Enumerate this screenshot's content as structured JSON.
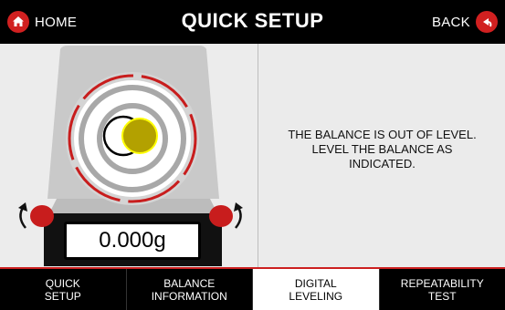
{
  "header": {
    "home_label": "HOME",
    "title": "QUICK SETUP",
    "back_label": "BACK"
  },
  "display": {
    "weight": "0.000g"
  },
  "message": {
    "lines": [
      "THE BALANCE IS OUT OF LEVEL.",
      "LEVEL THE BALANCE AS",
      "INDICATED."
    ]
  },
  "tabs": [
    {
      "label": "QUICK\nSETUP",
      "active": false
    },
    {
      "label": "BALANCE\nINFORMATION",
      "active": false
    },
    {
      "label": "DIGITAL\nLEVELING",
      "active": true
    },
    {
      "label": "REPEATABILITY\nTEST",
      "active": false
    }
  ],
  "colors": {
    "accent": "#d12020",
    "bubble": "#b3a100",
    "bubble_outline": "#ffff00",
    "header_bg": "#000000"
  },
  "icons": {
    "home": "home-icon",
    "back": "back-arrow-icon",
    "rotate_left": "rotate-counterclockwise-icon",
    "rotate_right": "rotate-clockwise-icon"
  }
}
